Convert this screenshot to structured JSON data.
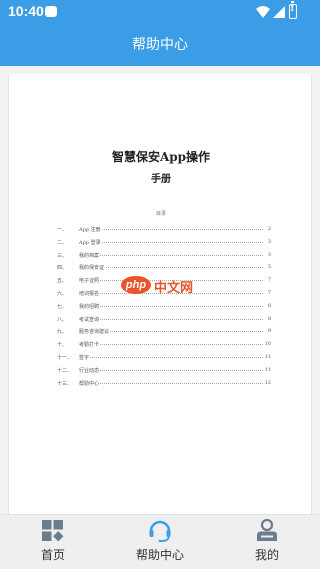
{
  "status_bar": {
    "time": "10:40"
  },
  "header": {
    "title": "帮助中心"
  },
  "document": {
    "title": "智慧保安App操作",
    "subtitle": "手册",
    "toc_heading": "目录",
    "toc": [
      {
        "num": "一、",
        "label": "App 注册",
        "page": "2"
      },
      {
        "num": "二、",
        "label": "App 登录",
        "page": "3"
      },
      {
        "num": "三、",
        "label": "我的档案",
        "page": "3"
      },
      {
        "num": "四、",
        "label": "我的保安证",
        "page": "5"
      },
      {
        "num": "五、",
        "label": "电子证照",
        "page": "7"
      },
      {
        "num": "六、",
        "label": "培训报名",
        "page": "7"
      },
      {
        "num": "七、",
        "label": "我的招聘",
        "page": "8"
      },
      {
        "num": "八、",
        "label": "考试查询",
        "page": "8"
      },
      {
        "num": "九、",
        "label": "服务咨询建议",
        "page": "9"
      },
      {
        "num": "十、",
        "label": "考勤打卡",
        "page": "10"
      },
      {
        "num": "十一、",
        "label": "签字",
        "page": "11"
      },
      {
        "num": "十二、",
        "label": "行业动态",
        "page": "11"
      },
      {
        "num": "十三、",
        "label": "帮助中心",
        "page": "12"
      }
    ],
    "watermark": {
      "logo_text": "php",
      "text": "中文网"
    }
  },
  "tabbar": {
    "items": [
      {
        "label": "首页",
        "icon": "home-grid-icon"
      },
      {
        "label": "帮助中心",
        "icon": "headset-icon"
      },
      {
        "label": "我的",
        "icon": "user-icon"
      }
    ]
  },
  "colors": {
    "primary": "#3a9de6",
    "watermark": "#e9542a",
    "tab_icon": "#6b7d8c",
    "tab_icon_active": "#3a9de6"
  }
}
